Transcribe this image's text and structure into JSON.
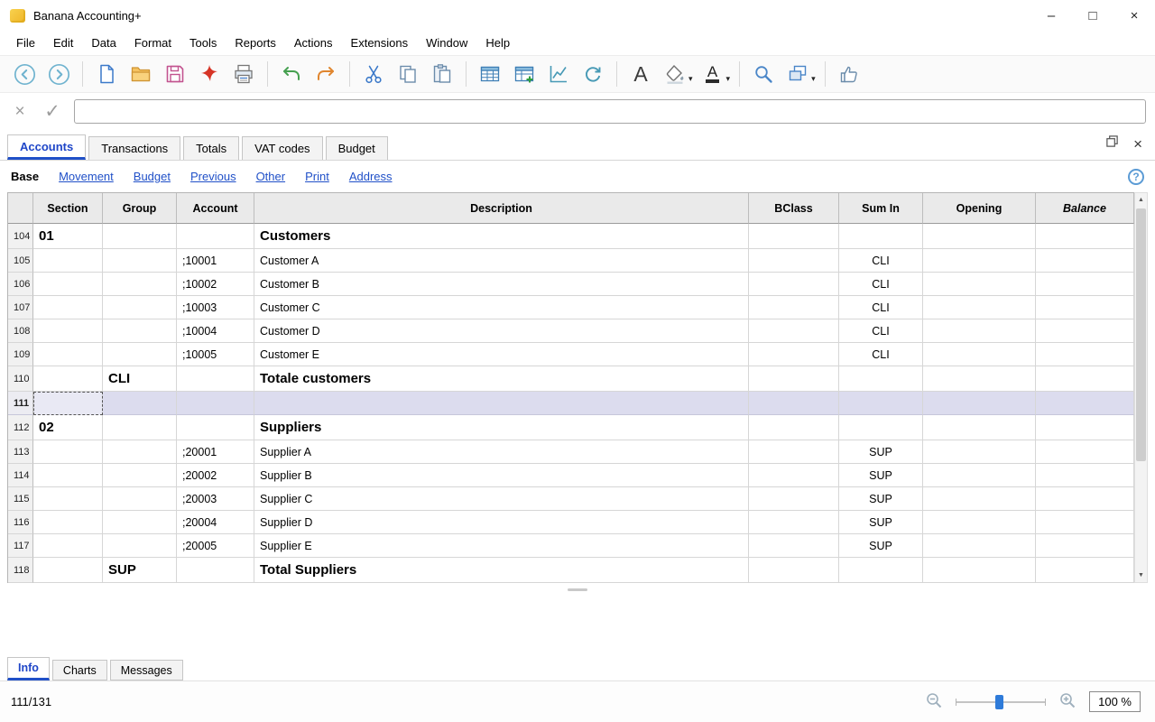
{
  "window": {
    "title": "Banana Accounting+",
    "controls": {
      "minimize": "–",
      "maximize": "□",
      "close": "×"
    }
  },
  "menu": {
    "items": [
      "File",
      "Edit",
      "Data",
      "Format",
      "Tools",
      "Reports",
      "Actions",
      "Extensions",
      "Window",
      "Help"
    ]
  },
  "toolbar": {
    "icons": [
      "back",
      "forward",
      "new-file",
      "open-file",
      "save",
      "export-pdf",
      "print",
      "undo",
      "redo",
      "cut",
      "copy",
      "paste",
      "insert-table-rows",
      "append-table-rows",
      "chart",
      "recalculate",
      "font-style",
      "background-color",
      "text-color",
      "find",
      "window-arrange",
      "feedback"
    ],
    "dropdown_glyph": "▾"
  },
  "edit_bar": {
    "cancel_glyph": "×",
    "confirm_glyph": "✓",
    "value": ""
  },
  "tabs": {
    "active": "Accounts",
    "items": [
      "Accounts",
      "Transactions",
      "Totals",
      "VAT codes",
      "Budget"
    ],
    "close_glyph": "×"
  },
  "views": {
    "label": "Base",
    "links": [
      "Movement",
      "Budget",
      "Previous",
      "Other",
      "Print",
      "Address"
    ],
    "help_glyph": "?"
  },
  "table": {
    "headers": [
      "Section",
      "Group",
      "Account",
      "Description",
      "BClass",
      "Sum In",
      "Opening",
      "Balance"
    ],
    "rows": [
      {
        "num": "104",
        "section": "01",
        "group": "",
        "account": "",
        "description": "Customers",
        "bclass": "",
        "sum_in": "",
        "opening": "",
        "balance": "",
        "type": "section"
      },
      {
        "num": "105",
        "section": "",
        "group": "",
        "account": ";10001",
        "description": "Customer A",
        "bclass": "",
        "sum_in": "CLI",
        "opening": "",
        "balance": "",
        "type": "normal"
      },
      {
        "num": "106",
        "section": "",
        "group": "",
        "account": ";10002",
        "description": "Customer B",
        "bclass": "",
        "sum_in": "CLI",
        "opening": "",
        "balance": "",
        "type": "normal"
      },
      {
        "num": "107",
        "section": "",
        "group": "",
        "account": ";10003",
        "description": "Customer C",
        "bclass": "",
        "sum_in": "CLI",
        "opening": "",
        "balance": "",
        "type": "normal"
      },
      {
        "num": "108",
        "section": "",
        "group": "",
        "account": ";10004",
        "description": "Customer D",
        "bclass": "",
        "sum_in": "CLI",
        "opening": "",
        "balance": "",
        "type": "normal"
      },
      {
        "num": "109",
        "section": "",
        "group": "",
        "account": ";10005",
        "description": "Customer E",
        "bclass": "",
        "sum_in": "CLI",
        "opening": "",
        "balance": "",
        "type": "normal"
      },
      {
        "num": "110",
        "section": "",
        "group": "CLI",
        "account": "",
        "description": "Totale customers",
        "bclass": "",
        "sum_in": "",
        "opening": "",
        "balance": "",
        "type": "total"
      },
      {
        "num": "111",
        "section": "",
        "group": "",
        "account": "",
        "description": "",
        "bclass": "",
        "sum_in": "",
        "opening": "",
        "balance": "",
        "type": "selected"
      },
      {
        "num": "112",
        "section": "02",
        "group": "",
        "account": "",
        "description": "Suppliers",
        "bclass": "",
        "sum_in": "",
        "opening": "",
        "balance": "",
        "type": "section"
      },
      {
        "num": "113",
        "section": "",
        "group": "",
        "account": ";20001",
        "description": "Supplier A",
        "bclass": "",
        "sum_in": "SUP",
        "opening": "",
        "balance": "",
        "type": "normal"
      },
      {
        "num": "114",
        "section": "",
        "group": "",
        "account": ";20002",
        "description": "Supplier B",
        "bclass": "",
        "sum_in": "SUP",
        "opening": "",
        "balance": "",
        "type": "normal"
      },
      {
        "num": "115",
        "section": "",
        "group": "",
        "account": ";20003",
        "description": "Supplier C",
        "bclass": "",
        "sum_in": "SUP",
        "opening": "",
        "balance": "",
        "type": "normal"
      },
      {
        "num": "116",
        "section": "",
        "group": "",
        "account": ";20004",
        "description": "Supplier D",
        "bclass": "",
        "sum_in": "SUP",
        "opening": "",
        "balance": "",
        "type": "normal"
      },
      {
        "num": "117",
        "section": "",
        "group": "",
        "account": ";20005",
        "description": "Supplier E",
        "bclass": "",
        "sum_in": "SUP",
        "opening": "",
        "balance": "",
        "type": "normal"
      },
      {
        "num": "118",
        "section": "",
        "group": "SUP",
        "account": "",
        "description": "Total Suppliers",
        "bclass": "",
        "sum_in": "",
        "opening": "",
        "balance": "",
        "type": "total"
      }
    ]
  },
  "scrollbar": {
    "up_glyph": "▲",
    "down_glyph": "▼"
  },
  "bottom_tabs": {
    "active": "Info",
    "items": [
      "Info",
      "Charts",
      "Messages"
    ]
  },
  "status": {
    "row_indicator": "111/131",
    "zoom_value": "100 %"
  }
}
